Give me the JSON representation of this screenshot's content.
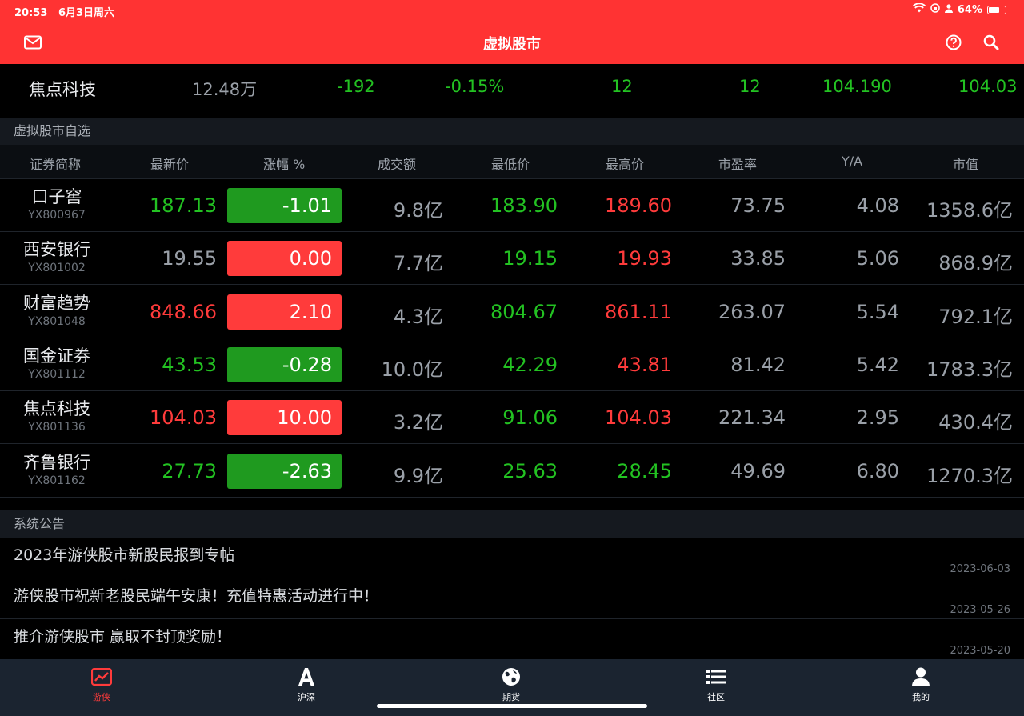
{
  "status": {
    "time": "20:53",
    "date": "6月3日周六",
    "battery": "64%",
    "battery_level": 0.64
  },
  "header": {
    "title": "虚拟股市",
    "mail_icon": "mail-icon",
    "help_icon": "help-icon",
    "search_icon": "search-icon"
  },
  "ticker": {
    "name": "焦点科技",
    "volume": "12.48万",
    "change": "-192",
    "change_pct": "-0.15%",
    "v1": "12",
    "v2": "12",
    "v3": "104.190",
    "v4": "104.03"
  },
  "watchlist": {
    "title": "虚拟股市自选",
    "columns": [
      "证券简称",
      "最新价",
      "涨幅 %",
      "成交额",
      "最低价",
      "最高价",
      "市盈率",
      "Y/A",
      "市值"
    ],
    "rows": [
      {
        "name": "口子窖",
        "code": "YX800967",
        "price": "187.13",
        "change": "-1.01",
        "amount": "9.8亿",
        "low": "183.90",
        "high": "189.60",
        "pe": "73.75",
        "ya": "4.08",
        "cap": "1358.6亿",
        "price_color": "green",
        "dir": "down",
        "low_color": "green",
        "high_color": "red"
      },
      {
        "name": "西安银行",
        "code": "YX801002",
        "price": "19.55",
        "change": "0.00",
        "amount": "7.7亿",
        "low": "19.15",
        "high": "19.93",
        "pe": "33.85",
        "ya": "5.06",
        "cap": "868.9亿",
        "price_color": "gray",
        "dir": "up",
        "low_color": "green",
        "high_color": "red"
      },
      {
        "name": "财富趋势",
        "code": "YX801048",
        "price": "848.66",
        "change": "2.10",
        "amount": "4.3亿",
        "low": "804.67",
        "high": "861.11",
        "pe": "263.07",
        "ya": "5.54",
        "cap": "792.1亿",
        "price_color": "red",
        "dir": "up",
        "low_color": "green",
        "high_color": "red"
      },
      {
        "name": "国金证券",
        "code": "YX801112",
        "price": "43.53",
        "change": "-0.28",
        "amount": "10.0亿",
        "low": "42.29",
        "high": "43.81",
        "pe": "81.42",
        "ya": "5.42",
        "cap": "1783.3亿",
        "price_color": "green",
        "dir": "down",
        "low_color": "green",
        "high_color": "red"
      },
      {
        "name": "焦点科技",
        "code": "YX801136",
        "price": "104.03",
        "change": "10.00",
        "amount": "3.2亿",
        "low": "91.06",
        "high": "104.03",
        "pe": "221.34",
        "ya": "2.95",
        "cap": "430.4亿",
        "price_color": "red",
        "dir": "up",
        "low_color": "green",
        "high_color": "red"
      },
      {
        "name": "齐鲁银行",
        "code": "YX801162",
        "price": "27.73",
        "change": "-2.63",
        "amount": "9.9亿",
        "low": "25.63",
        "high": "28.45",
        "pe": "49.69",
        "ya": "6.80",
        "cap": "1270.3亿",
        "price_color": "green",
        "dir": "down",
        "low_color": "green",
        "high_color": "green"
      }
    ]
  },
  "notices": {
    "title": "系统公告",
    "items": [
      {
        "title": "2023年游侠股市新股民报到专帖",
        "date": "2023-06-03"
      },
      {
        "title": "游侠股市祝新老股民端午安康！充值特惠活动进行中！",
        "date": "2023-05-26"
      },
      {
        "title": "推介游侠股市 赢取不封顶奖励！",
        "date": "2023-05-20"
      }
    ]
  },
  "tabs": [
    {
      "label": "游侠",
      "icon": "chart-icon",
      "active": true
    },
    {
      "label": "沪深",
      "icon": "letter-a-icon",
      "active": false
    },
    {
      "label": "期货",
      "icon": "globe-icon",
      "active": false
    },
    {
      "label": "社区",
      "icon": "list-icon",
      "active": false
    },
    {
      "label": "我的",
      "icon": "user-icon",
      "active": false
    }
  ],
  "colors": {
    "brand": "#ff3333",
    "up": "#ff3b3b",
    "down": "#23c222",
    "badge_down": "#1f9a1f"
  }
}
